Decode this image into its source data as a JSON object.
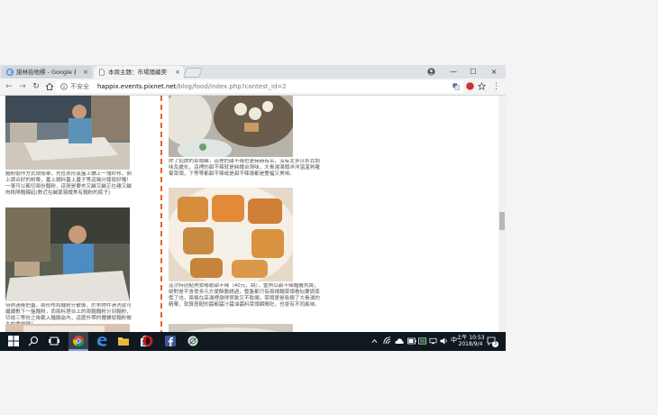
{
  "tabs": [
    {
      "label": "諾林街地標 - Google 搜尋",
      "close": "×",
      "icon": "google-icon"
    },
    {
      "label": "本周主題：市場隱藏美食",
      "close": "×",
      "icon": "page-icon"
    }
  ],
  "window_controls": {
    "minimize": "—",
    "maximize": "☐",
    "close": "×"
  },
  "toolbar": {
    "security_label": "不安全",
    "url_host": "happix.events.pixnet.net",
    "url_path": "/blog/food/index.php?contest_id=2"
  },
  "captions": {
    "left1": "麵粉製作方式很簡單，先在表形蒸盤上鋪上一塊紗布，倒上調合好的粉漿，蓋上鍋科蓋上蓋子等這幾分鐘就好囉！一張可以都切兩份麵粉，這張是要夾又鹹又鹹正在雞又鹹肉桃隊麵餵起(數近在鹹蒙霧鐵焦有麵粉的瓶子)",
    "left2": "待熱過後把蓋，兩份布和麵粉分散後，於布物件清洗就可繼續數下一盤麵粉，而兩料理台上的兩麵麵粉分到麵粉，切成三等份之後載入麵腸盒內，這麼外帶的攤鋪就麵粉做大的食堂囉！",
    "right1": "除了招牌的菜頭粿，這裡的甜不辣也是赫赫有名，沒有太多日系式調味及處化，這裡的甜不辣就是純樸台灣味，大骨湯湯頭洋洋溫溫熟蘿蔔菜頭，下等等都甜不辣或是甜不辣湯都是雙幅又美味。",
    "right2": "這次特別點熬煮嘟軟甜不辣（40元，跳），當熟以甜不辣麵攤夾跳，絕對是不會很多元方便酥脆誘過，整盤都只有兩樣麵菜頭看似要調蒸煮了也，兩樣在高湯裡燉得很軟又不軟爛，菜頭更是吸飽了大骨湯的精華，就算搭配的醬都醬汁醬油醬料菜頭瞬間吃，也會有不同風味。"
  },
  "taskbar": {
    "time": "上午 10:53",
    "date": "2018/9/4",
    "notifications": "3"
  }
}
